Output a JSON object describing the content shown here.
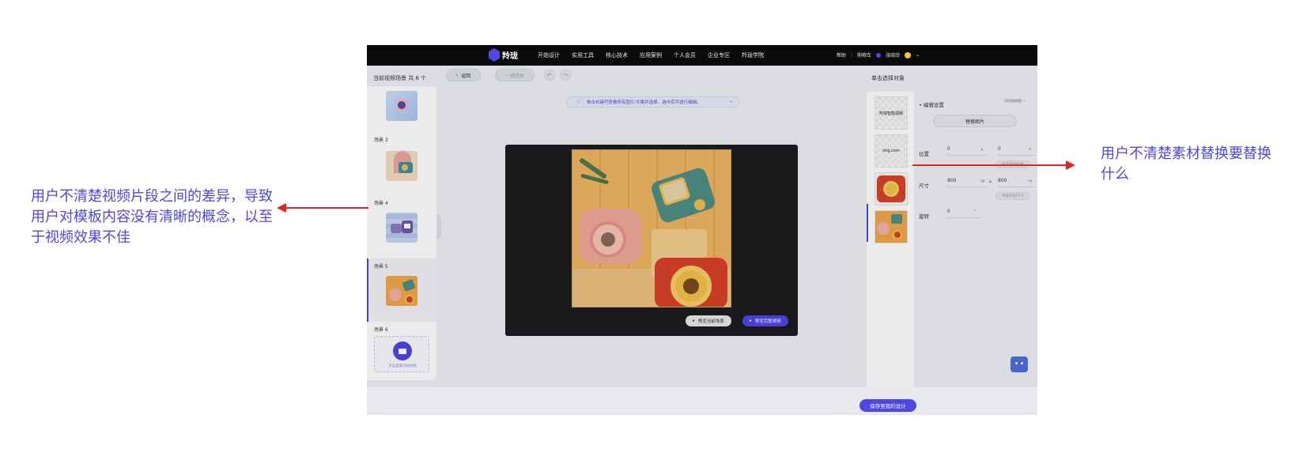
{
  "app": {
    "logo_text": "羚珑",
    "nav": [
      "开始设计",
      "实用工具",
      "核心技术",
      "应用案例",
      "个人会员",
      "企业专区",
      "羚珑学院"
    ],
    "help": "帮助",
    "cart": "购物车",
    "cart_count": "0",
    "username": "张晓欣"
  },
  "toolbar": {
    "scene_title": "当前视频场景   共 6 个",
    "back": "返回",
    "one_click": "一键还原",
    "object_title": "单击选择对象"
  },
  "tip": "单击右键可查看所有图片/文案并选择，选中后可进行编辑。",
  "scenes": [
    {
      "label": "",
      "active": false
    },
    {
      "label": "场景 3",
      "active": false
    },
    {
      "label": "场景 4",
      "active": false
    },
    {
      "label": "场景 5",
      "active": true
    },
    {
      "label": "场景 6",
      "active": false
    }
  ],
  "upload_hint": "点击直接添加视频",
  "preview": {
    "current": "预览当前场景",
    "full": "预览完整视频"
  },
  "objects": [
    {
      "label": "羚珑智能视频"
    },
    {
      "label": "ling.com"
    },
    {
      "label": ""
    },
    {
      "label": ""
    }
  ],
  "edit": {
    "title": "• 编辑设置",
    "right_link": "添加编辑器 •",
    "replace": "替换图片",
    "position_label": "位置",
    "pos_x": "0",
    "pos_y": "0",
    "x_unit": "X",
    "y_unit": "Y",
    "pos_reset": "恢复初始位置",
    "size_label": "尺寸",
    "w": "800",
    "h": "800",
    "w_unit": "W",
    "h_unit": "H",
    "size_reset": "恢复初始尺寸",
    "rotate_label": "旋转",
    "rotate": "0",
    "deg": "°"
  },
  "footer": {
    "save": "保存至我的设计"
  },
  "annotations": {
    "left": "用户不清楚视频片段之间的差异，导致用户对模板内容没有清晰的概念，以至于视频效果不佳",
    "right": "用户不清楚素材替换要替换什么"
  },
  "colors": {
    "accent": "#4f46e5",
    "arrow": "#d62828"
  }
}
